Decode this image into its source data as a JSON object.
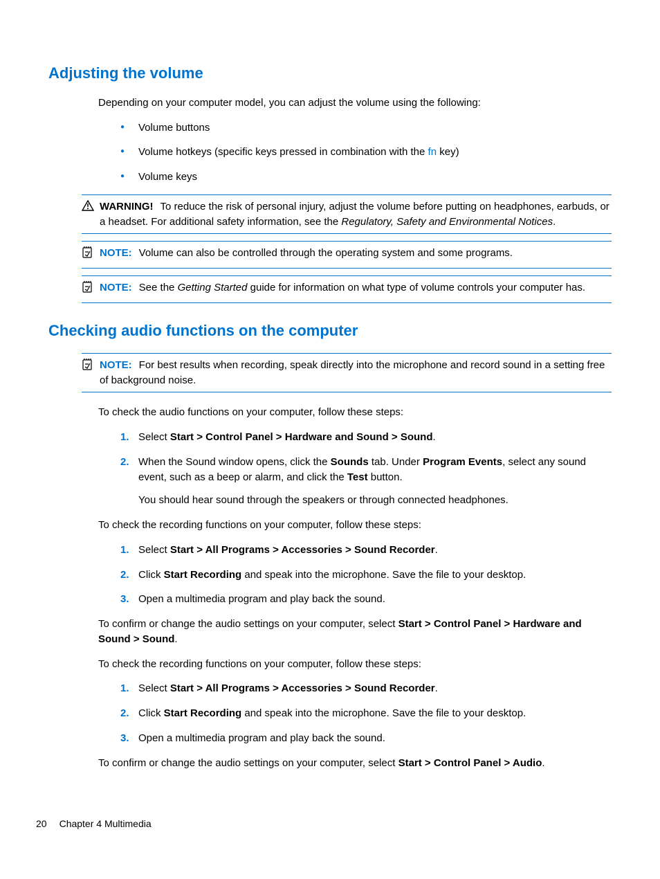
{
  "section1": {
    "heading": "Adjusting the volume",
    "intro": "Depending on your computer model, you can adjust the volume using the following:",
    "bullets": {
      "b1": "Volume buttons",
      "b2a": "Volume hotkeys (specific keys pressed in combination with the ",
      "b2fn": "fn",
      "b2b": " key)",
      "b3": "Volume keys"
    },
    "warning": {
      "label": "WARNING!",
      "text_a": "To reduce the risk of personal injury, adjust the volume before putting on headphones, earbuds, or a headset. For additional safety information, see the ",
      "text_italic": "Regulatory, Safety and Environmental Notices",
      "text_b": "."
    },
    "note1": {
      "label": "NOTE:",
      "text": "Volume can also be controlled through the operating system and some programs."
    },
    "note2": {
      "label": "NOTE:",
      "text_a": "See the ",
      "text_italic": "Getting Started",
      "text_b": " guide for information on what type of volume controls your computer has."
    }
  },
  "section2": {
    "heading": "Checking audio functions on the computer",
    "note": {
      "label": "NOTE:",
      "text": "For best results when recording, speak directly into the microphone and record sound in a setting free of background noise."
    },
    "para1": "To check the audio functions on your computer, follow these steps:",
    "steps1": {
      "s1a": "Select ",
      "s1b": "Start > Control Panel > Hardware and Sound > Sound",
      "s1c": ".",
      "s2a": "When the Sound window opens, click the ",
      "s2b": "Sounds",
      "s2c": " tab. Under ",
      "s2d": "Program Events",
      "s2e": ", select any sound event, such as a beep or alarm, and click the ",
      "s2f": "Test",
      "s2g": " button.",
      "s2sub": "You should hear sound through the speakers or through connected headphones."
    },
    "para2": "To check the recording functions on your computer, follow these steps:",
    "steps2": {
      "s1a": "Select ",
      "s1b": "Start > All Programs > Accessories > Sound Recorder",
      "s1c": ".",
      "s2a": "Click ",
      "s2b": "Start Recording",
      "s2c": " and speak into the microphone. Save the file to your desktop.",
      "s3": "Open a multimedia program and play back the sound."
    },
    "para3a": "To confirm or change the audio settings on your computer, select ",
    "para3b": "Start > Control Panel > Hardware and Sound > Sound",
    "para3c": ".",
    "para4": "To check the recording functions on your computer, follow these steps:",
    "steps3": {
      "s1a": "Select ",
      "s1b": "Start > All Programs > Accessories > Sound Recorder",
      "s1c": ".",
      "s2a": "Click ",
      "s2b": "Start Recording",
      "s2c": " and speak into the microphone. Save the file to your desktop.",
      "s3": "Open a multimedia program and play back the sound."
    },
    "para5a": "To confirm or change the audio settings on your computer, select ",
    "para5b": "Start > Control Panel > Audio",
    "para5c": "."
  },
  "footer": {
    "page": "20",
    "chapter": "Chapter 4   Multimedia"
  }
}
